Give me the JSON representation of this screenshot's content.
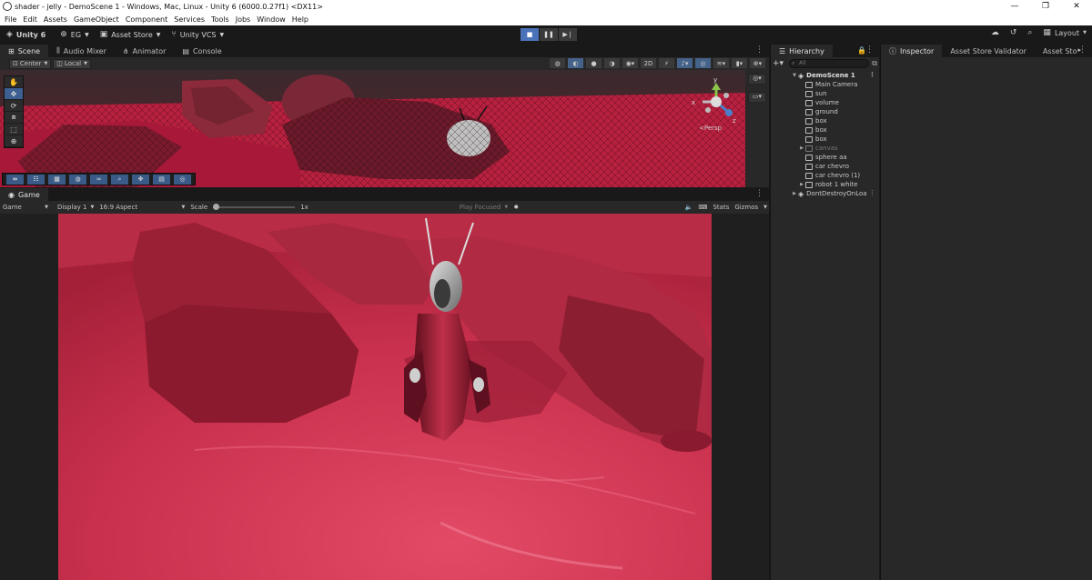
{
  "window": {
    "title": "shader - jelly - DemoScene 1 - Windows, Mac, Linux - Unity 6 (6000.0.27f1) <DX11>",
    "controls": [
      "—",
      "❐",
      "✕"
    ]
  },
  "menu": [
    "File",
    "Edit",
    "Assets",
    "GameObject",
    "Component",
    "Services",
    "Tools",
    "Jobs",
    "Window",
    "Help"
  ],
  "toolbar": {
    "account": "Unity 6",
    "org": "EG",
    "asset_store": "Asset Store",
    "vcs": "Unity VCS",
    "layout": "Layout"
  },
  "scene_panel": {
    "tabs": [
      "Scene",
      "Audio Mixer",
      "Animator",
      "Console"
    ],
    "pivot": "Center",
    "space": "Local",
    "persp_label": "<Persp",
    "gizmo_axes": {
      "y": "y",
      "x": "x",
      "z": "z"
    }
  },
  "game_panel": {
    "tab": "Game",
    "mode": "Game",
    "display": "Display 1",
    "aspect": "16:9 Aspect",
    "scale_label": "Scale",
    "scale_value": "1x",
    "play_focused": "Play Focused",
    "stats": "Stats",
    "gizmos": "Gizmos"
  },
  "hierarchy": {
    "tab": "Hierarchy",
    "search_placeholder": "All",
    "nodes": [
      {
        "label": "DemoScene 1",
        "level": 0,
        "type": "scene",
        "bold": true
      },
      {
        "label": "Main Camera",
        "level": 1,
        "type": "object"
      },
      {
        "label": "sun",
        "level": 1,
        "type": "object"
      },
      {
        "label": "volume",
        "level": 1,
        "type": "object"
      },
      {
        "label": "ground",
        "level": 1,
        "type": "object"
      },
      {
        "label": "box",
        "level": 1,
        "type": "object"
      },
      {
        "label": "box",
        "level": 1,
        "type": "object"
      },
      {
        "label": "box",
        "level": 1,
        "type": "object"
      },
      {
        "label": "canvas",
        "level": 1,
        "type": "object",
        "collapsed": true,
        "dim": true
      },
      {
        "label": "sphere aa",
        "level": 1,
        "type": "object"
      },
      {
        "label": "car chevro",
        "level": 1,
        "type": "object"
      },
      {
        "label": "car chevro (1)",
        "level": 1,
        "type": "object"
      },
      {
        "label": "robot 1 white",
        "level": 1,
        "type": "object",
        "collapsed": true
      },
      {
        "label": "DontDestroyOnLoa",
        "level": 0,
        "type": "scene",
        "collapsed": true
      }
    ]
  },
  "inspector": {
    "tabs": [
      "Inspector",
      "Asset Store Validator",
      "Asset Sto"
    ]
  },
  "colors": {
    "accent": "#4a72b8",
    "jelly": "#c8354f",
    "panel": "#282828"
  }
}
